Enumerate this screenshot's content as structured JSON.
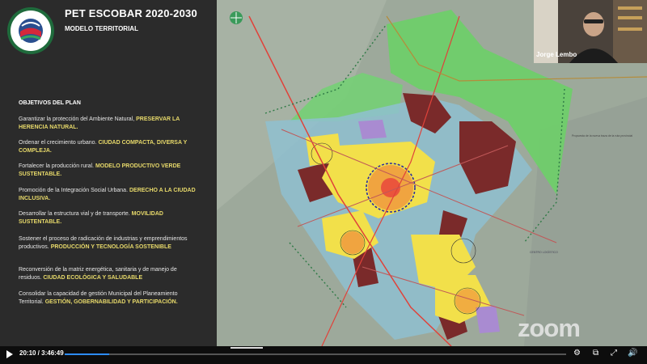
{
  "slide": {
    "logo": {
      "line1": "ESCOBAR",
      "line2": "SOSTENIBLE"
    },
    "title": "PET ESCOBAR 2020-2030",
    "subtitle": "MODELO TERRITORIAL",
    "objectives_heading": "OBJETIVOS DEL PLAN",
    "objectives": [
      {
        "text": "Garantizar la protección del Ambiente Natural, ",
        "highlight": "PRESERVAR LA HERENCIA NATURAL."
      },
      {
        "text": "Ordenar el crecimiento urbano. ",
        "highlight": "CIUDAD COMPACTA, DIVERSA Y COMPLEJA."
      },
      {
        "text": "Fortalecer la producción rural. ",
        "highlight": "MODELO PRODUCTIVO VERDE SUSTENTABLE."
      },
      {
        "text": "Promoción de la Integración Social Urbana. ",
        "highlight": "DERECHO A LA CIUDAD INCLUSIVA."
      },
      {
        "text": "Desarrollar la estructura vial y de transporte. ",
        "highlight": "MOVILIDAD SUSTENTABLE."
      },
      {
        "text": "Sostener el proceso de radicación de industrias y emprendimientos productivos. ",
        "highlight": "PRODUCCIÓN Y TECNOLOGÍA SOSTENIBLE"
      },
      {
        "text": "Reconversión de la matriz energética, sanitaria y de manejo de residuos. ",
        "highlight": "CIUDAD ECOLÓGICA Y SALUDABLE"
      },
      {
        "text": "Consolidar la capacidad de gestión Municipal del Planeamiento Territorial. ",
        "highlight": "GESTIÓN, GOBERNABILIDAD Y PARTICIPACIÓN."
      }
    ],
    "map": {
      "note1": "Propuesta de la nueva traza de la ruta provincial",
      "note2": "CENTRO LOGÍSTICO"
    }
  },
  "participant": {
    "name": "Jorge Lembo"
  },
  "watermark": "zoom",
  "player": {
    "time": "20:10 / 3:46:49",
    "progress": 0.089,
    "icons": [
      "play-icon",
      "settings-icon",
      "pip-icon",
      "fullscreen-icon",
      "volume-icon"
    ]
  },
  "colors": {
    "accent_text": "#e7d96a",
    "panel_bg": "#2b2b2b",
    "progress_fill": "#2d8cff",
    "zone_green": "#6fce6a",
    "zone_yellow": "#f2e04a",
    "zone_maroon": "#7a2a2a",
    "zone_blue": "#8fbfd0",
    "zone_purple": "#a98bd1"
  }
}
